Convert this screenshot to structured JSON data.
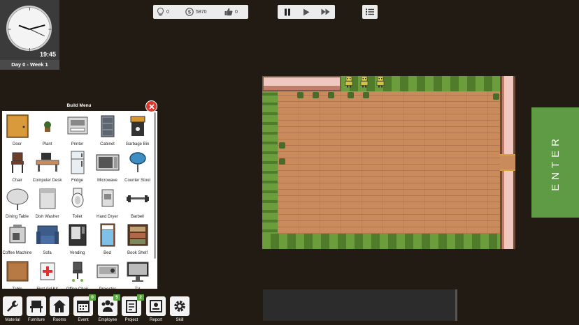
{
  "clock": {
    "time": "19:45",
    "day_label": "Day 0 - Week 1"
  },
  "stats": {
    "ideas": "0",
    "money": "5870",
    "likes": "0"
  },
  "speed_controls": [
    "pause-icon",
    "play-icon",
    "fast-forward-icon"
  ],
  "build_menu": {
    "title": "Build Menu",
    "items": [
      {
        "label": "Door",
        "icon": "door-icon"
      },
      {
        "label": "Plant",
        "icon": "plant-icon"
      },
      {
        "label": "Printer",
        "icon": "printer-icon"
      },
      {
        "label": "Cabinet",
        "icon": "cabinet-icon"
      },
      {
        "label": "Garbage Bin",
        "icon": "garbage-bin-icon"
      },
      {
        "label": "Chair",
        "icon": "chair-icon"
      },
      {
        "label": "Computer Desk",
        "icon": "computer-desk-icon"
      },
      {
        "label": "Fridge",
        "icon": "fridge-icon"
      },
      {
        "label": "Microwave",
        "icon": "microwave-icon"
      },
      {
        "label": "Counter Stool",
        "icon": "counter-stool-icon"
      },
      {
        "label": "Dining Table",
        "icon": "dining-table-icon"
      },
      {
        "label": "Dish Washer",
        "icon": "dish-washer-icon"
      },
      {
        "label": "Toilet",
        "icon": "toilet-icon"
      },
      {
        "label": "Hand Dryer",
        "icon": "hand-dryer-icon"
      },
      {
        "label": "Barbell",
        "icon": "barbell-icon"
      },
      {
        "label": "Coffee Machine",
        "icon": "coffee-machine-icon"
      },
      {
        "label": "Sofa",
        "icon": "sofa-icon"
      },
      {
        "label": "Vending",
        "icon": "vending-icon"
      },
      {
        "label": "Bed",
        "icon": "bed-icon"
      },
      {
        "label": "Book Shelf",
        "icon": "book-shelf-icon"
      },
      {
        "label": "Table",
        "icon": "table-icon"
      },
      {
        "label": "First Aid Kit",
        "icon": "first-aid-kit-icon"
      },
      {
        "label": "Office Chair",
        "icon": "office-chair-icon"
      },
      {
        "label": "Projector",
        "icon": "projector-icon"
      },
      {
        "label": "TV",
        "icon": "tv-icon"
      }
    ]
  },
  "toolbar": [
    {
      "label": "Material",
      "icon": "wrench-icon",
      "badge": ""
    },
    {
      "label": "Furniture",
      "icon": "furniture-icon",
      "badge": ""
    },
    {
      "label": "Rooms",
      "icon": "house-icon",
      "badge": ""
    },
    {
      "label": "Event",
      "icon": "calendar-icon",
      "badge": "0"
    },
    {
      "label": "Employee",
      "icon": "people-icon",
      "badge": "5"
    },
    {
      "label": "Project",
      "icon": "project-icon",
      "badge": "2"
    },
    {
      "label": "Report",
      "icon": "report-icon",
      "badge": ""
    },
    {
      "label": "Skill",
      "icon": "gear-icon",
      "badge": ""
    }
  ],
  "enter_button": {
    "label": "ENTER"
  },
  "colors": {
    "background": "#221b13",
    "accent_green": "#5f9a45",
    "close_red": "#d9382e",
    "floor": "#c98a5c"
  }
}
